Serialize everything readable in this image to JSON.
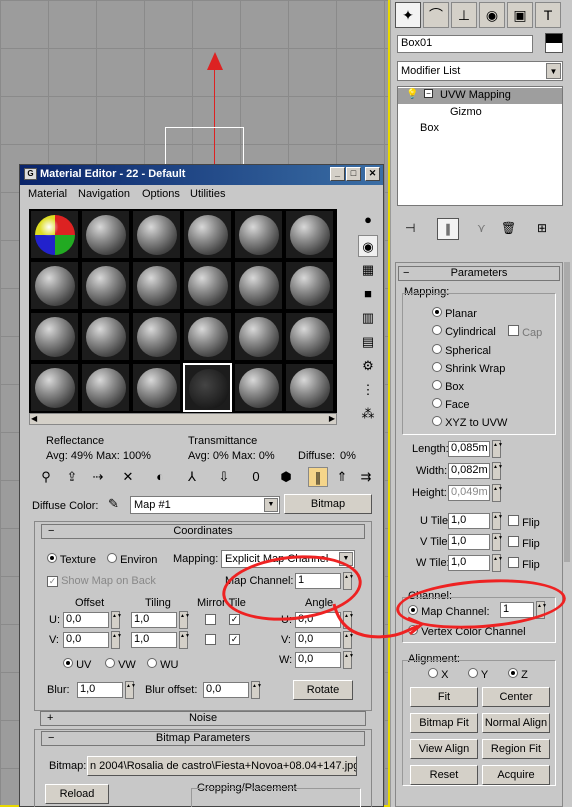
{
  "command_panel": {
    "object_name": "Box01",
    "modifier_list": "Modifier List",
    "stack": [
      "UVW Mapping",
      "Gizmo",
      "Box"
    ],
    "parameters": {
      "title": "Parameters",
      "mapping_label": "Mapping:",
      "mapping_options": [
        "Planar",
        "Cylindrical",
        "Spherical",
        "Shrink Wrap",
        "Box",
        "Face",
        "XYZ to UVW"
      ],
      "cap_label": "Cap",
      "length_label": "Length:",
      "length_value": "0,085m",
      "width_label": "Width:",
      "width_value": "0,082m",
      "height_label": "Height:",
      "height_value": "0,049m",
      "utile_label": "U Tile:",
      "utile_value": "1,0",
      "vtile_label": "V Tile:",
      "vtile_value": "1,0",
      "wtile_label": "W Tile:",
      "wtile_value": "1,0",
      "flip_label": "Flip",
      "channel_label": "Channel:",
      "map_channel_label": "Map Channel:",
      "map_channel_value": "1",
      "vertex_color_label": "Vertex Color Channel",
      "alignment_label": "Alignment:",
      "axis_x": "X",
      "axis_y": "Y",
      "axis_z": "Z",
      "buttons": [
        "Fit",
        "Center",
        "Bitmap Fit",
        "Normal Align",
        "View Align",
        "Region Fit",
        "Reset",
        "Acquire"
      ]
    }
  },
  "material_editor": {
    "title": "Material Editor - 22 - Default",
    "menu": [
      "Material",
      "Navigation",
      "Options",
      "Utilities"
    ],
    "reflectance_label": "Reflectance",
    "reflectance_values": "Avg:   49% Max: 100%",
    "transmittance_label": "Transmittance",
    "transmittance_values": "Avg:    0% Max:     0%",
    "diffuse_label": "Diffuse:",
    "diffuse_value": "0%",
    "diffuse_color_label": "Diffuse Color:",
    "map_name": "Map #1",
    "map_type": "Bitmap",
    "coordinates": {
      "title": "Coordinates",
      "texture_label": "Texture",
      "environ_label": "Environ",
      "mapping_label": "Mapping:",
      "mapping_value": "Explicit Map Channel",
      "show_map_label": "Show Map on Back",
      "map_channel_label": "Map Channel:",
      "map_channel_value": "1",
      "offset_label": "Offset",
      "tiling_label": "Tiling",
      "mirror_tile_label": "Mirror Tile",
      "angle_label": "Angle",
      "u_label": "U:",
      "v_label": "V:",
      "w_label": "W:",
      "u_offset": "0,0",
      "v_offset": "0,0",
      "u_tiling": "1,0",
      "v_tiling": "1,0",
      "u_angle": "0,0",
      "v_angle": "0,0",
      "w_angle": "0,0",
      "uv_label": "UV",
      "vw_label": "VW",
      "wu_label": "WU",
      "blur_label": "Blur:",
      "blur_value": "1,0",
      "blur_offset_label": "Blur offset:",
      "blur_offset_value": "0,0",
      "rotate_label": "Rotate"
    },
    "noise_title": "Noise",
    "bitmap_params_title": "Bitmap Parameters",
    "bitmap_label": "Bitmap:",
    "bitmap_path": "n 2004\\Rosalia de castro\\Fiesta+Novoa+08.04+147.jpg",
    "reload_label": "Reload",
    "cropping_label": "Cropping/Placement"
  },
  "colors": {
    "title_bar": "#0a246a",
    "annotation": "#e22222",
    "viewport_border": "#e8d800"
  }
}
